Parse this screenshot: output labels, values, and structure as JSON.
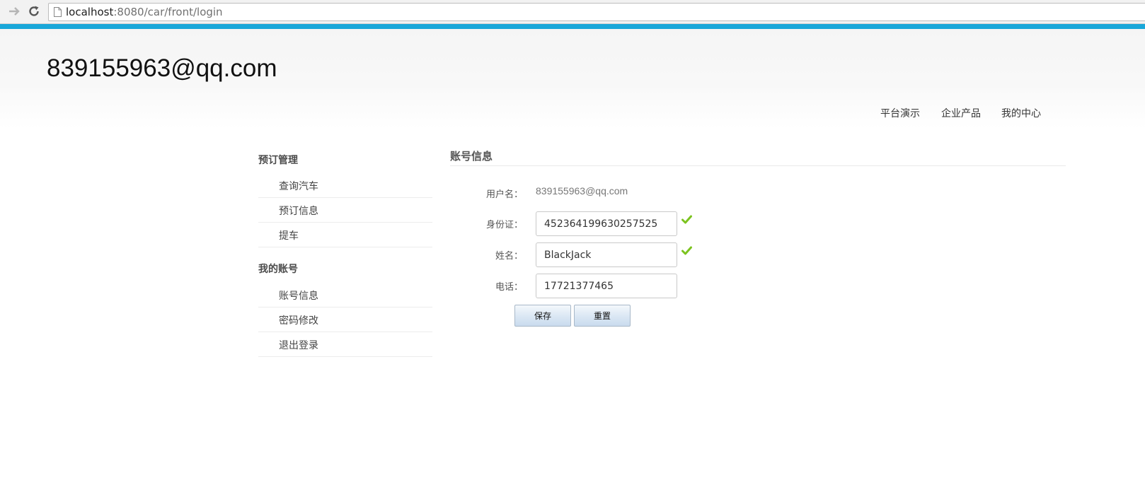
{
  "browser": {
    "url_host": "localhost",
    "url_rest": ":8080/car/front/login"
  },
  "header": {
    "site_title": "839155963@qq.com",
    "nav": [
      "平台演示",
      "企业产品",
      "我的中心"
    ]
  },
  "sidebar": {
    "sections": [
      {
        "title": "预订管理",
        "items": [
          "查询汽车",
          "预订信息",
          "提车"
        ]
      },
      {
        "title": "我的账号",
        "items": [
          "账号信息",
          "密码修改",
          "退出登录"
        ]
      }
    ]
  },
  "main": {
    "title": "账号信息",
    "form": {
      "username_label": "用户名：",
      "username_value": "839155963@qq.com",
      "id_label": "身份证：",
      "id_value": "452364199630257525",
      "name_label": "姓名：",
      "name_value": "BlackJack",
      "phone_label": "电话：",
      "phone_value": "17721377465"
    },
    "buttons": {
      "save": "保存",
      "reset": "重置"
    }
  },
  "colors": {
    "accent": "#19a7d9",
    "check_green": "#7cc31f"
  }
}
